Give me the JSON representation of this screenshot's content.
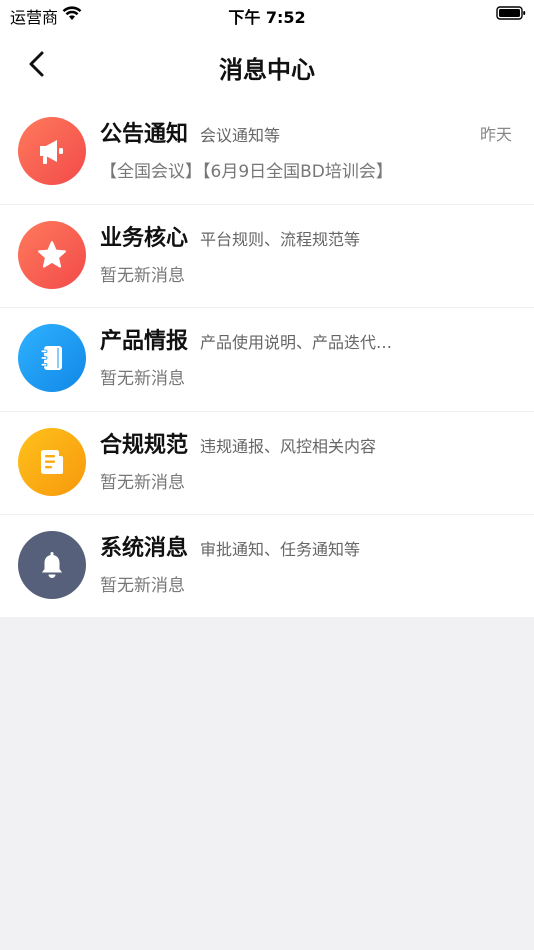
{
  "status_bar": {
    "carrier": "运营商",
    "time": "下午 7:52"
  },
  "nav": {
    "title": "消息中心"
  },
  "categories": [
    {
      "title": "公告通知",
      "subtitle": "会议通知等",
      "time": "昨天",
      "message": "【全国会议】【6月9日全国BD培训会】",
      "icon": "megaphone-icon",
      "color": "#f5574f"
    },
    {
      "title": "业务核心",
      "subtitle": "平台规则、流程规范等",
      "time": "",
      "message": "暂无新消息",
      "icon": "star-icon",
      "color": "#f5574f"
    },
    {
      "title": "产品情报",
      "subtitle": "产品使用说明、产品迭代…",
      "time": "",
      "message": "暂无新消息",
      "icon": "notebook-icon",
      "color": "#1a9cf2"
    },
    {
      "title": "合规规范",
      "subtitle": "违规通报、风控相关内容",
      "time": "",
      "message": "暂无新消息",
      "icon": "document-icon",
      "color": "#fbaa0f"
    },
    {
      "title": "系统消息",
      "subtitle": "审批通知、任务通知等",
      "time": "",
      "message": "暂无新消息",
      "icon": "bell-icon",
      "color": "#5a6376"
    }
  ]
}
